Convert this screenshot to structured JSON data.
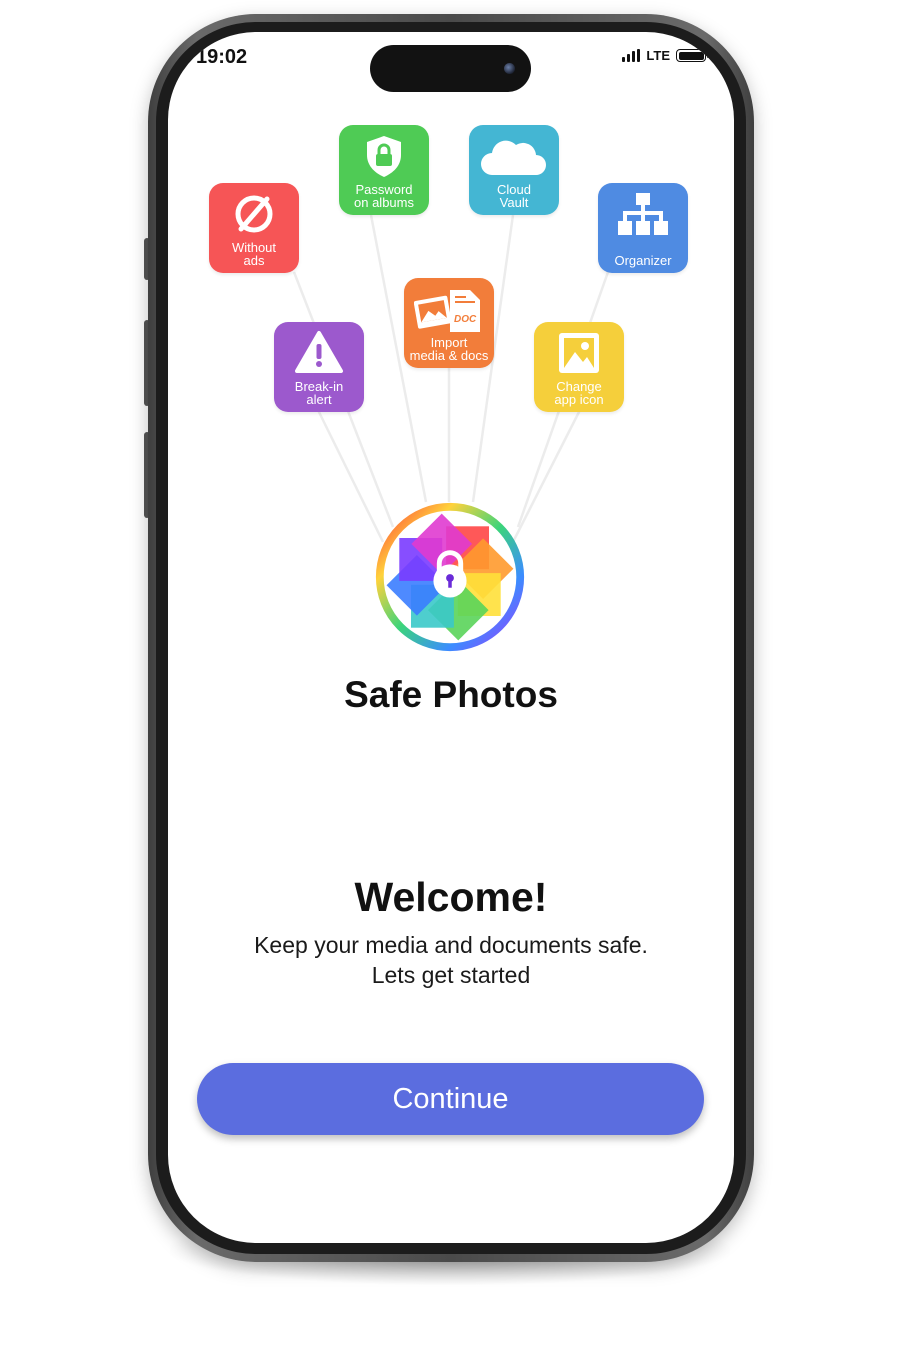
{
  "status_bar": {
    "time": "19:02",
    "network": "LTE"
  },
  "features": [
    {
      "label": "Without\nads",
      "color": "#f65556",
      "icon": "no-ads-icon"
    },
    {
      "label": "Password\non albums",
      "color": "#4fcb55",
      "icon": "lock-shield-icon"
    },
    {
      "label": "Cloud\nVault",
      "color": "#44b6d3",
      "icon": "cloud-icon"
    },
    {
      "label": "Organizer",
      "color": "#4f8be2",
      "icon": "hierarchy-icon"
    },
    {
      "label": "Import\nmedia & docs",
      "color": "#f27d3a",
      "icon": "import-docs-icon",
      "doc_tag": "DOC"
    },
    {
      "label": "Break-in\nalert",
      "color": "#9c59cd",
      "icon": "warning-icon"
    },
    {
      "label": "Change\napp icon",
      "color": "#f5cf3b",
      "icon": "image-icon"
    }
  ],
  "app_name": "Safe Photos",
  "welcome": {
    "title": "Welcome!",
    "line1": "Keep your media and documents safe.",
    "line2": "Lets get started"
  },
  "continue_label": "Continue"
}
